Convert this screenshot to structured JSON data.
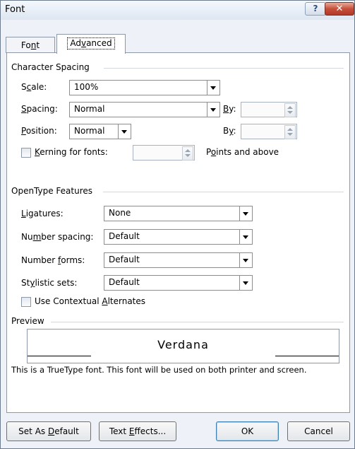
{
  "dialog": {
    "title": "Font",
    "help_glyph": "?",
    "close_glyph": "✕"
  },
  "tabs": {
    "font": {
      "pre": "Fo",
      "key": "n",
      "post": "t"
    },
    "advanced": {
      "pre": "Ad",
      "key": "v",
      "post": "anced"
    }
  },
  "character_spacing": {
    "heading": "Character Spacing",
    "scale": {
      "pre": "S",
      "key": "c",
      "post": "ale:",
      "value": "100%"
    },
    "spacing": {
      "pre": "",
      "key": "S",
      "post": "pacing:",
      "value": "Normal"
    },
    "spacing_by": {
      "pre": "",
      "key": "B",
      "post": "y:",
      "value": ""
    },
    "position": {
      "pre": "",
      "key": "P",
      "post": "osition:",
      "value": "Normal"
    },
    "position_by": {
      "pre": "B",
      "key": "y",
      "post": ":",
      "value": ""
    },
    "kerning": {
      "pre": "",
      "key": "K",
      "post": "erning for fonts:",
      "value": "",
      "checked": false
    },
    "points": {
      "pre": "P",
      "key": "o",
      "post": "ints and above"
    }
  },
  "opentype": {
    "heading": "OpenType Features",
    "ligatures": {
      "pre": "",
      "key": "L",
      "post": "igatures:",
      "value": "None"
    },
    "number_spacing": {
      "pre": "Nu",
      "key": "m",
      "post": "ber spacing:",
      "value": "Default"
    },
    "number_forms": {
      "pre": "Number ",
      "key": "f",
      "post": "orms:",
      "value": "Default"
    },
    "stylistic_sets": {
      "pre": "St",
      "key": "y",
      "post": "listic sets:",
      "value": "Default"
    },
    "contextual": {
      "pre": "Use Contextual ",
      "key": "A",
      "post": "lternates",
      "checked": false
    }
  },
  "preview": {
    "heading": "Preview",
    "sample": "Verdana",
    "description": "This is a TrueType font. This font will be used on both printer and screen."
  },
  "buttons": {
    "set_default": {
      "pre": "Set As ",
      "key": "D",
      "post": "efault"
    },
    "text_effects": {
      "pre": "Text ",
      "key": "E",
      "post": "ffects..."
    },
    "ok": "OK",
    "cancel": "Cancel"
  }
}
